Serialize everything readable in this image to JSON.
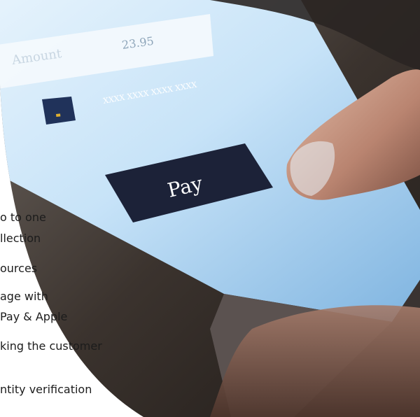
{
  "photo": {
    "amount_label": "Amount",
    "amount_value": "23.95",
    "card_number": "XXXX XXXX XXXX XXXX",
    "pay_label": "Pay"
  },
  "text_lines": [
    "o to one",
    "llection",
    "ources",
    "age with",
    "Pay & Apple",
    "king the customer",
    "ntity verification",
    ""
  ],
  "colors": {
    "screen_light": "#d4e9f8",
    "screen_mid": "#9ecbee",
    "pay_button": "#1c2238",
    "skin": "#c89a85",
    "dark_bg": "#2a2522"
  }
}
